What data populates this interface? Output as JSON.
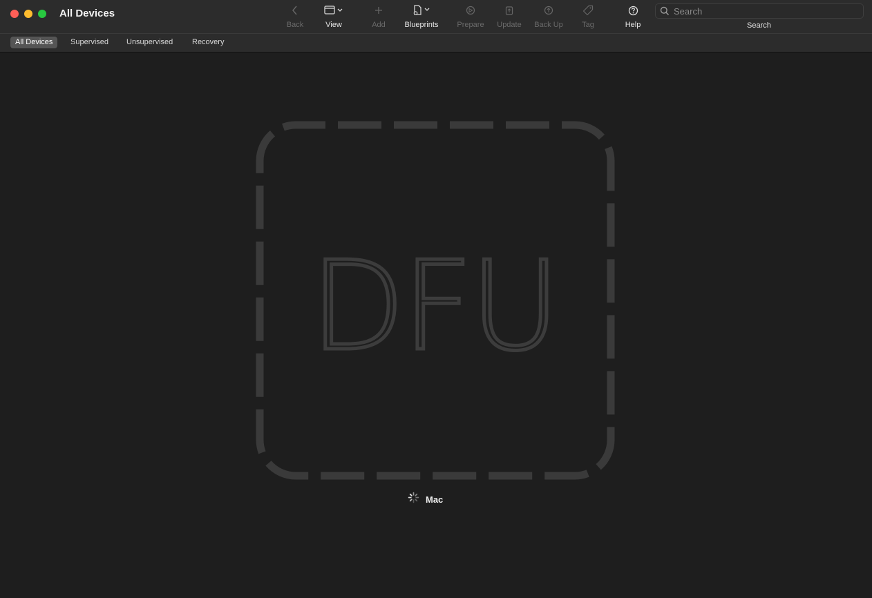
{
  "window": {
    "title": "All Devices"
  },
  "toolbar": {
    "back": {
      "label": "Back",
      "icon": "chevron-left-icon"
    },
    "view": {
      "label": "View",
      "icon": "window-view-icon"
    },
    "add": {
      "label": "Add",
      "icon": "plus-icon"
    },
    "blueprints": {
      "label": "Blueprints",
      "icon": "blueprint-icon"
    },
    "prepare": {
      "label": "Prepare",
      "icon": "prepare-icon"
    },
    "update": {
      "label": "Update",
      "icon": "update-icon"
    },
    "backup": {
      "label": "Back Up",
      "icon": "backup-icon"
    },
    "tag": {
      "label": "Tag",
      "icon": "tag-icon"
    },
    "help": {
      "label": "Help",
      "icon": "question-circle-icon"
    }
  },
  "search": {
    "placeholder": "Search",
    "label": "Search"
  },
  "filters": [
    {
      "label": "All Devices",
      "active": true
    },
    {
      "label": "Supervised",
      "active": false
    },
    {
      "label": "Unsupervised",
      "active": false
    },
    {
      "label": "Recovery",
      "active": false
    }
  ],
  "device": {
    "mode_text": "DFU",
    "name": "Mac",
    "status": "loading"
  },
  "colors": {
    "close": "#ff5f57",
    "minimize": "#febc2e",
    "maximize": "#28c840",
    "placeholder_outline": "#3a3a3a"
  }
}
